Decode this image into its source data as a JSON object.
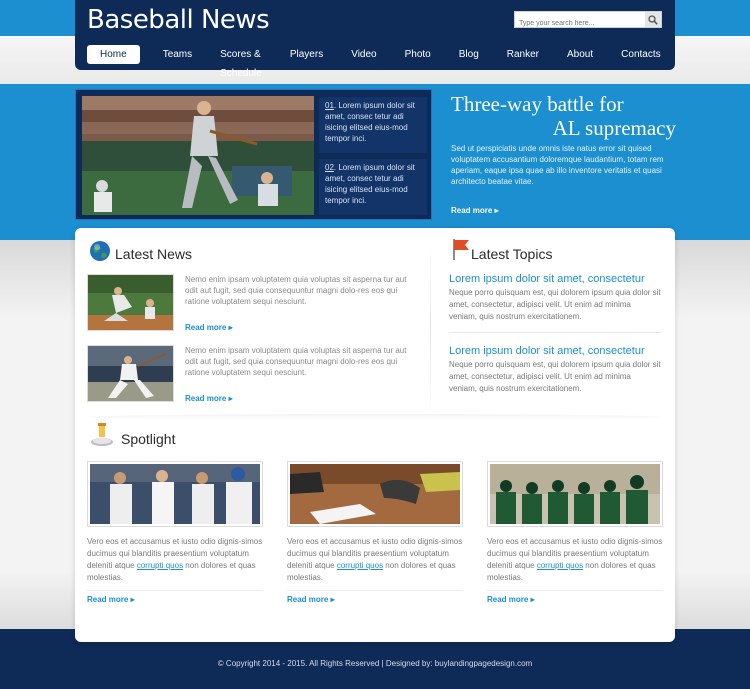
{
  "site": {
    "logo": "Baseball News"
  },
  "search": {
    "placeholder": "Type your search here..."
  },
  "nav": {
    "items": [
      "Home",
      "Teams",
      "Scores & Schedule",
      "Players",
      "Video",
      "Photo",
      "Blog",
      "Ranker",
      "About",
      "Contacts"
    ]
  },
  "hero": {
    "items": [
      {
        "num": "01",
        "text": ". Lorem ipsum dolor sit amet, consec tetur adi isicing elitsed eius-mod tempor inci."
      },
      {
        "num": "02",
        "text": ". Lorem ipsum dolor sit amet, consec tetur adi isicing elitsed eius-mod tempor inci."
      }
    ],
    "headline_line1": "Three-way battle for",
    "headline_line2": "AL supremacy",
    "text": "Sed ut perspiciatis unde omnis iste natus error sit quised voluptatem accusantium doloremque laudantium, totam rem aperiam, eaque ipsa quae ab illo inventore veritatis et quasi architecto beatae vitae.",
    "read_more": "Read more ▸"
  },
  "latest_news": {
    "title": "Latest News",
    "items": [
      {
        "text": "Nemo enim ipsam voluptatem quia voluptas sit asperna tur aut odit aut fugit, sed quia consequuntur magni dolo-res eos qui ratione voluptatem sequi nesciunt.",
        "read_more": "Read more ▸"
      },
      {
        "text": "Nemo enim ipsam voluptatem quia voluptas sit asperna tur aut odit aut fugit, sed quia consequuntur magni dolo-res eos qui ratione voluptatem sequi nesciunt.",
        "read_more": "Read more ▸"
      }
    ]
  },
  "latest_topics": {
    "title": "Latest Topics",
    "items": [
      {
        "title": "Lorem ipsum dolor sit amet, consectetur",
        "text": "Neque porro quisquam est, qui dolorem ipsum quia dolor sit amet, consectetur, adipisci velit. Ut enim ad minima veniam, quis nostrum exercitationem."
      },
      {
        "title": "Lorem ipsum dolor sit amet, consectetur",
        "text": "Neque porro quisquam est, qui dolorem ipsum quia dolor sit amet, consectetur, adipisci velit. Ut enim ad minima veniam, quis nostrum exercitationem."
      }
    ]
  },
  "spotlight": {
    "title": "Spotlight",
    "items": [
      {
        "text_before": "Vero eos et accusamus et iusto odio dignis-simos ducimus qui blanditis praesentium voluptatum deleniti atque ",
        "link": "corrupti quos",
        "text_after": " non dolores et quas molestias.",
        "read_more": "Read more ▸"
      },
      {
        "text_before": "Vero eos et accusamus et iusto odio dignis-simos ducimus qui blanditis praesentium voluptatum deleniti atque ",
        "link": "corrupti quos",
        "text_after": " non dolores et quas molestias.",
        "read_more": "Read more ▸"
      },
      {
        "text_before": "Vero eos et accusamus et iusto odio dignis-simos ducimus qui blanditis praesentium voluptatum deleniti atque ",
        "link": "corrupti quos",
        "text_after": " non dolores et quas molestias.",
        "read_more": "Read more ▸"
      }
    ]
  },
  "footer": {
    "text": "© Copyright 2014 - 2015. All Rights Reserved | Designed by: buylandingpagedesign.com"
  },
  "colors": {
    "accent_blue": "#1b8fd0",
    "navy": "#0e2a57",
    "text_gray": "#7a7a7a"
  },
  "icons": [
    "search-icon",
    "globe-icon",
    "flag-icon",
    "spotlight-icon"
  ]
}
